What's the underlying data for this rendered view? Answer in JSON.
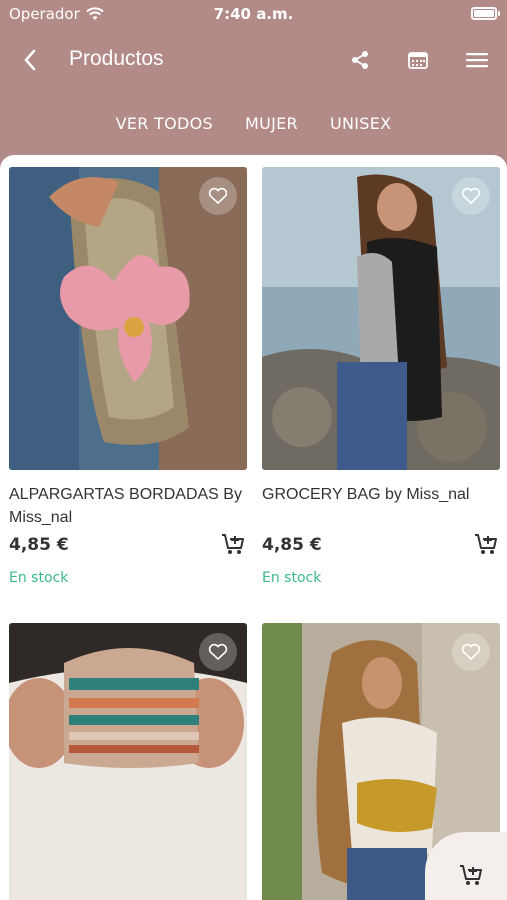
{
  "status_bar": {
    "carrier": "Operador",
    "time": "7:40 a.m."
  },
  "header": {
    "title": "Productos"
  },
  "tabs": [
    {
      "label": "VER TODOS"
    },
    {
      "label": "MUJER"
    },
    {
      "label": "UNISEX"
    }
  ],
  "products": [
    {
      "name": "ALPARGARTAS BORDADAS By Miss_nal",
      "price": "4,85 €",
      "stock": "En stock"
    },
    {
      "name": "GROCERY BAG by Miss_nal",
      "price": "4,85 €",
      "stock": "En stock"
    },
    {
      "name": "",
      "price": "",
      "stock": ""
    },
    {
      "name": "",
      "price": "",
      "stock": ""
    }
  ],
  "colors": {
    "brand": "#b28a88",
    "stock_green": "#3bb98a",
    "text": "#333333"
  },
  "icons": {
    "back": "chevron-left-icon",
    "share": "share-icon",
    "calendar": "calendar-icon",
    "menu": "hamburger-icon",
    "favorite": "heart-icon",
    "cart": "add-cart-icon",
    "wifi": "wifi-icon",
    "battery": "battery-icon"
  }
}
